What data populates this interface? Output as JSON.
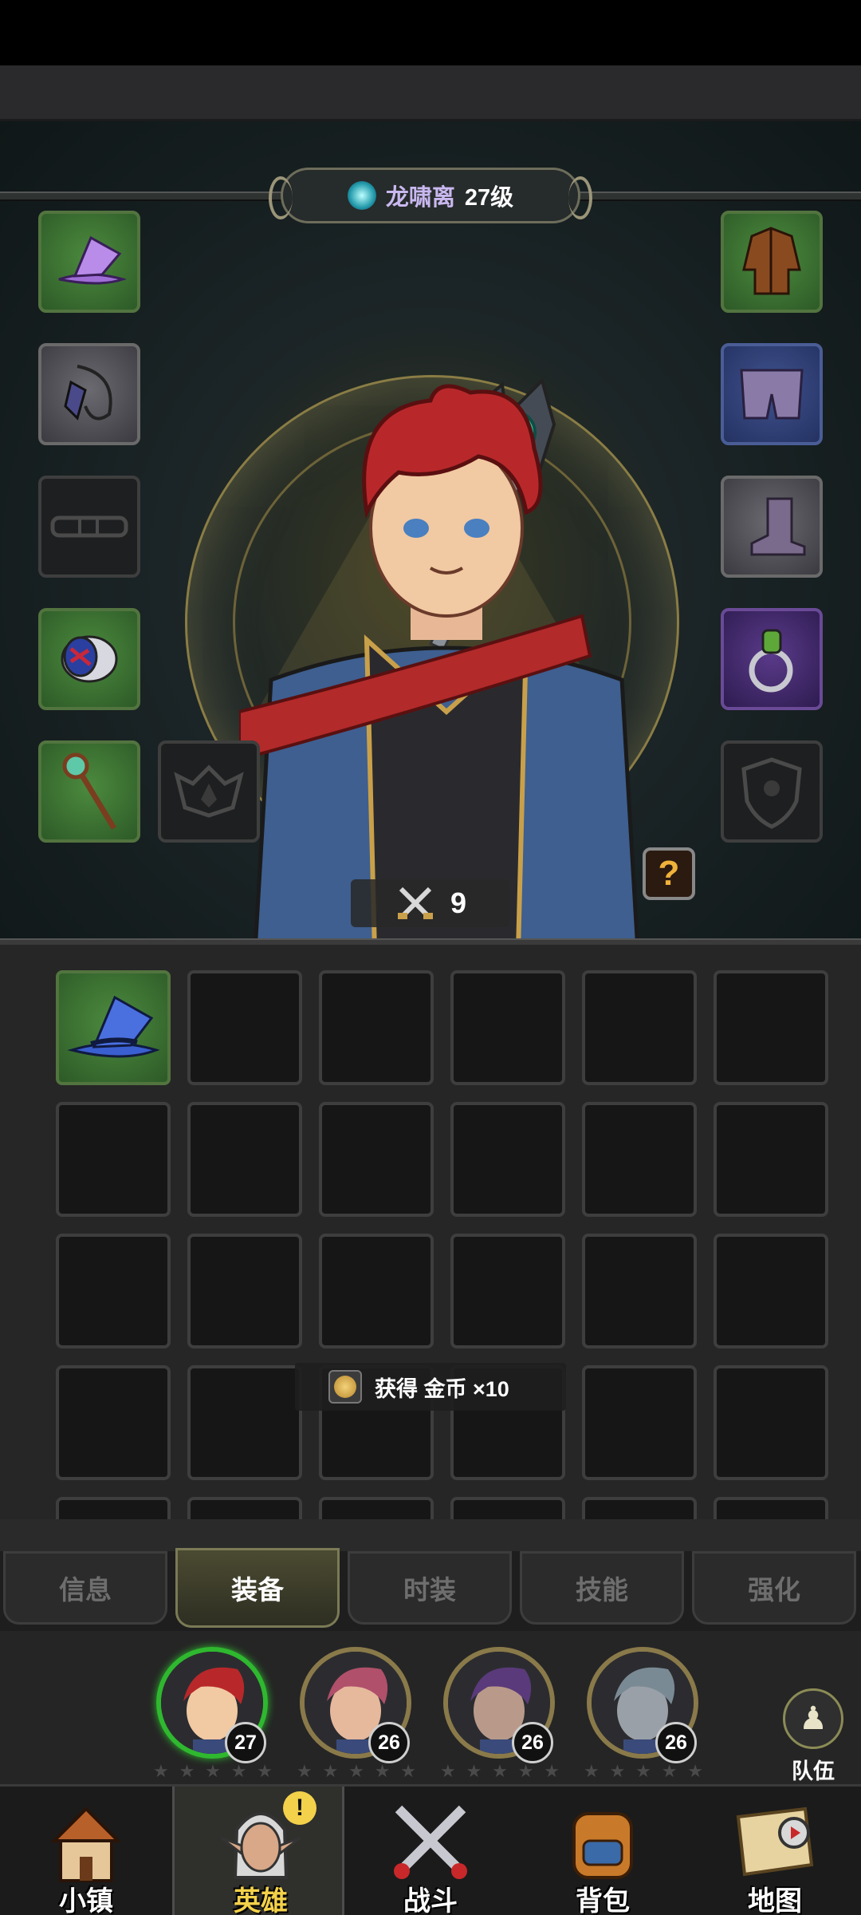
{
  "hero": {
    "name": "龙啸离",
    "level": "27级",
    "power": "9"
  },
  "left_slots": [
    {
      "name": "hat",
      "rarity": "green"
    },
    {
      "name": "necklace",
      "rarity": "gray"
    },
    {
      "name": "belt",
      "rarity": "empty"
    },
    {
      "name": "bracer",
      "rarity": "green"
    },
    {
      "name": "staff",
      "rarity": "green"
    },
    {
      "name": "offhand",
      "rarity": "empty"
    }
  ],
  "right_slots": [
    {
      "name": "robe",
      "rarity": "green"
    },
    {
      "name": "pants",
      "rarity": "blue"
    },
    {
      "name": "boots",
      "rarity": "gray"
    },
    {
      "name": "ring",
      "rarity": "purple"
    },
    {
      "name": "shield",
      "rarity": "empty"
    }
  ],
  "inventory": {
    "items": [
      {
        "name": "blue-wizard-hat",
        "rarity": "green"
      }
    ]
  },
  "toast": {
    "text": "获得 金币 ×10"
  },
  "tabs": [
    "信息",
    "装备",
    "时装",
    "技能",
    "强化"
  ],
  "active_tab": 1,
  "roster": [
    {
      "level": "27",
      "selected": true,
      "hair": "#b8282a",
      "skin": "#f1c9a2"
    },
    {
      "level": "26",
      "selected": false,
      "hair": "#b0506a",
      "skin": "#e6b89c"
    },
    {
      "level": "26",
      "selected": false,
      "hair": "#5a3a7a",
      "skin": "#b99a8a"
    },
    {
      "level": "26",
      "selected": false,
      "hair": "#7a8a95",
      "skin": "#9aa0a8"
    }
  ],
  "team": {
    "label": "队伍"
  },
  "nav": [
    {
      "label": "小镇",
      "icon": "town-icon",
      "active": false
    },
    {
      "label": "英雄",
      "icon": "hero-icon",
      "active": true,
      "alert": "!"
    },
    {
      "label": "战斗",
      "icon": "battle-icon",
      "active": false
    },
    {
      "label": "背包",
      "icon": "backpack-icon",
      "active": false
    },
    {
      "label": "地图",
      "icon": "map-icon",
      "active": false
    }
  ],
  "colors": {
    "green_rarity": "#2d5a27",
    "blue_rarity": "#243262",
    "purple_rarity": "#2e1c50",
    "name_color": "#c9b8f0",
    "active_nav": "#f3d14a"
  }
}
